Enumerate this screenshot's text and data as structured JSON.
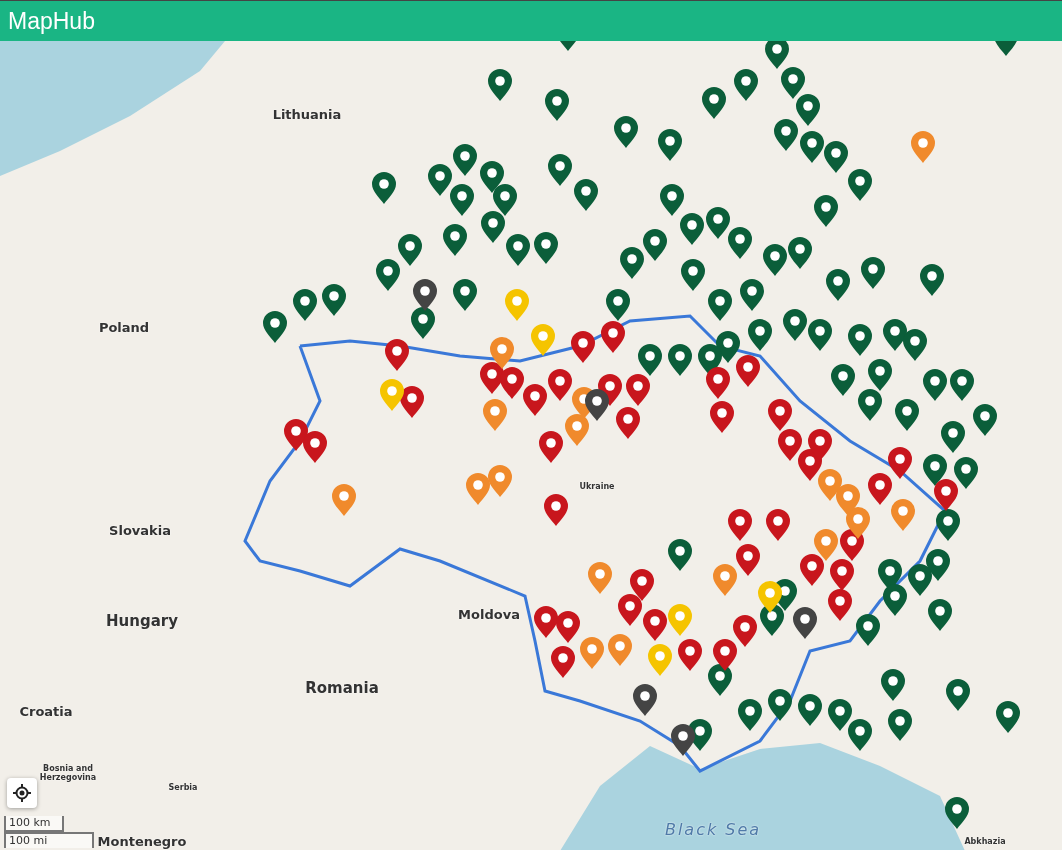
{
  "header": {
    "title": "MapHub"
  },
  "map_labels": [
    {
      "text": "Lithuania",
      "kind": "country"
    },
    {
      "text": "Poland",
      "kind": "country"
    },
    {
      "text": "Ukraine",
      "kind": "small"
    },
    {
      "text": "Slovakia",
      "kind": "country"
    },
    {
      "text": "Hungary",
      "kind": "large"
    },
    {
      "text": "Moldova",
      "kind": "country"
    },
    {
      "text": "Romania",
      "kind": "large"
    },
    {
      "text": "Croatia",
      "kind": "country"
    },
    {
      "text": "Bosnia and Herzegovina",
      "kind": "small"
    },
    {
      "text": "Serbia",
      "kind": "small"
    },
    {
      "text": "Montenegro",
      "kind": "country"
    },
    {
      "text": "Black Sea",
      "kind": "sea"
    },
    {
      "text": "Abkhazia",
      "kind": "small"
    }
  ],
  "scale": {
    "metric": "100 km",
    "imperial": "100 mi"
  },
  "pins": [
    {
      "color": "#0b5e3a"
    },
    {
      "color": "#0b5e3a"
    },
    {
      "color": "#0b5e3a"
    },
    {
      "color": "#0b5e3a"
    },
    {
      "color": "#0b5e3a"
    },
    {
      "color": "#0b5e3a"
    },
    {
      "color": "#0b5e3a"
    },
    {
      "color": "#0b5e3a"
    },
    {
      "color": "#0b5e3a"
    },
    {
      "color": "#0b5e3a"
    },
    {
      "color": "#0b5e3a"
    },
    {
      "color": "#0b5e3a"
    },
    {
      "color": "#0b5e3a"
    },
    {
      "color": "#0b5e3a"
    },
    {
      "color": "#0b5e3a"
    },
    {
      "color": "#0b5e3a"
    },
    {
      "color": "#0b5e3a"
    },
    {
      "color": "#0b5e3a"
    },
    {
      "color": "#0b5e3a"
    },
    {
      "color": "#0b5e3a"
    },
    {
      "color": "#0b5e3a"
    },
    {
      "color": "#0b5e3a"
    },
    {
      "color": "#0b5e3a"
    },
    {
      "color": "#0b5e3a"
    },
    {
      "color": "#0b5e3a"
    },
    {
      "color": "#0b5e3a"
    },
    {
      "color": "#0b5e3a"
    },
    {
      "color": "#0b5e3a"
    },
    {
      "color": "#0b5e3a"
    },
    {
      "color": "#0b5e3a"
    },
    {
      "color": "#0b5e3a"
    },
    {
      "color": "#0b5e3a"
    },
    {
      "color": "#0b5e3a"
    },
    {
      "color": "#0b5e3a"
    },
    {
      "color": "#0b5e3a"
    },
    {
      "color": "#0b5e3a"
    },
    {
      "color": "#0b5e3a"
    },
    {
      "color": "#0b5e3a"
    },
    {
      "color": "#0b5e3a"
    },
    {
      "color": "#0b5e3a"
    },
    {
      "color": "#0b5e3a"
    },
    {
      "color": "#0b5e3a"
    },
    {
      "color": "#0b5e3a"
    },
    {
      "color": "#0b5e3a"
    },
    {
      "color": "#0b5e3a"
    },
    {
      "color": "#0b5e3a"
    },
    {
      "color": "#0b5e3a"
    },
    {
      "color": "#0b5e3a"
    },
    {
      "color": "#0b5e3a"
    },
    {
      "color": "#0b5e3a"
    },
    {
      "color": "#0b5e3a"
    },
    {
      "color": "#0b5e3a"
    },
    {
      "color": "#0b5e3a"
    },
    {
      "color": "#0b5e3a"
    },
    {
      "color": "#0b5e3a"
    },
    {
      "color": "#0b5e3a"
    },
    {
      "color": "#0b5e3a"
    },
    {
      "color": "#0b5e3a"
    },
    {
      "color": "#0b5e3a"
    },
    {
      "color": "#0b5e3a"
    },
    {
      "color": "#0b5e3a"
    },
    {
      "color": "#0b5e3a"
    },
    {
      "color": "#0b5e3a"
    },
    {
      "color": "#0b5e3a"
    },
    {
      "color": "#0b5e3a"
    },
    {
      "color": "#0b5e3a"
    },
    {
      "color": "#0b5e3a"
    },
    {
      "color": "#0b5e3a"
    },
    {
      "color": "#0b5e3a"
    },
    {
      "color": "#0b5e3a"
    },
    {
      "color": "#0b5e3a"
    },
    {
      "color": "#0b5e3a"
    },
    {
      "color": "#0b5e3a"
    },
    {
      "color": "#0b5e3a"
    },
    {
      "color": "#0b5e3a"
    },
    {
      "color": "#0b5e3a"
    },
    {
      "color": "#0b5e3a"
    },
    {
      "color": "#0b5e3a"
    },
    {
      "color": "#0b5e3a"
    },
    {
      "color": "#0b5e3a"
    },
    {
      "color": "#0b5e3a"
    },
    {
      "color": "#0b5e3a"
    },
    {
      "color": "#0b5e3a"
    },
    {
      "color": "#0b5e3a"
    },
    {
      "color": "#0b5e3a"
    },
    {
      "color": "#0b5e3a"
    },
    {
      "color": "#0b5e3a"
    },
    {
      "color": "#0b5e3a"
    },
    {
      "color": "#0b5e3a"
    },
    {
      "color": "#0b5e3a"
    },
    {
      "color": "#0b5e3a"
    },
    {
      "color": "#0b5e3a"
    },
    {
      "color": "#c8161d"
    },
    {
      "color": "#c8161d"
    },
    {
      "color": "#c8161d"
    },
    {
      "color": "#c8161d"
    },
    {
      "color": "#c8161d"
    },
    {
      "color": "#c8161d"
    },
    {
      "color": "#c8161d"
    },
    {
      "color": "#c8161d"
    },
    {
      "color": "#c8161d"
    },
    {
      "color": "#c8161d"
    },
    {
      "color": "#c8161d"
    },
    {
      "color": "#c8161d"
    },
    {
      "color": "#c8161d"
    },
    {
      "color": "#c8161d"
    },
    {
      "color": "#c8161d"
    },
    {
      "color": "#c8161d"
    },
    {
      "color": "#c8161d"
    },
    {
      "color": "#c8161d"
    },
    {
      "color": "#c8161d"
    },
    {
      "color": "#c8161d"
    },
    {
      "color": "#c8161d"
    },
    {
      "color": "#c8161d"
    },
    {
      "color": "#c8161d"
    },
    {
      "color": "#c8161d"
    },
    {
      "color": "#c8161d"
    },
    {
      "color": "#c8161d"
    },
    {
      "color": "#c8161d"
    },
    {
      "color": "#c8161d"
    },
    {
      "color": "#c8161d"
    },
    {
      "color": "#c8161d"
    },
    {
      "color": "#c8161d"
    },
    {
      "color": "#c8161d"
    },
    {
      "color": "#c8161d"
    },
    {
      "color": "#c8161d"
    },
    {
      "color": "#c8161d"
    },
    {
      "color": "#c8161d"
    },
    {
      "color": "#c8161d"
    },
    {
      "color": "#c8161d"
    },
    {
      "color": "#c8161d"
    },
    {
      "color": "#c8161d"
    },
    {
      "color": "#c8161d"
    },
    {
      "color": "#f08a2c"
    },
    {
      "color": "#f08a2c"
    },
    {
      "color": "#f08a2c"
    },
    {
      "color": "#f08a2c"
    },
    {
      "color": "#f08a2c"
    },
    {
      "color": "#f08a2c"
    },
    {
      "color": "#f08a2c"
    },
    {
      "color": "#f08a2c"
    },
    {
      "color": "#f08a2c"
    },
    {
      "color": "#f08a2c"
    },
    {
      "color": "#f08a2c"
    },
    {
      "color": "#f08a2c"
    },
    {
      "color": "#f08a2c"
    },
    {
      "color": "#f08a2c"
    },
    {
      "color": "#f08a2c"
    },
    {
      "color": "#f08a2c"
    },
    {
      "color": "#f08a2c"
    },
    {
      "color": "#f5c400"
    },
    {
      "color": "#f5c400"
    },
    {
      "color": "#f5c400"
    },
    {
      "color": "#f5c400"
    },
    {
      "color": "#f5c400"
    },
    {
      "color": "#f5c400"
    },
    {
      "color": "#444444"
    },
    {
      "color": "#444444"
    },
    {
      "color": "#444444"
    },
    {
      "color": "#444444"
    },
    {
      "color": "#444444"
    }
  ]
}
